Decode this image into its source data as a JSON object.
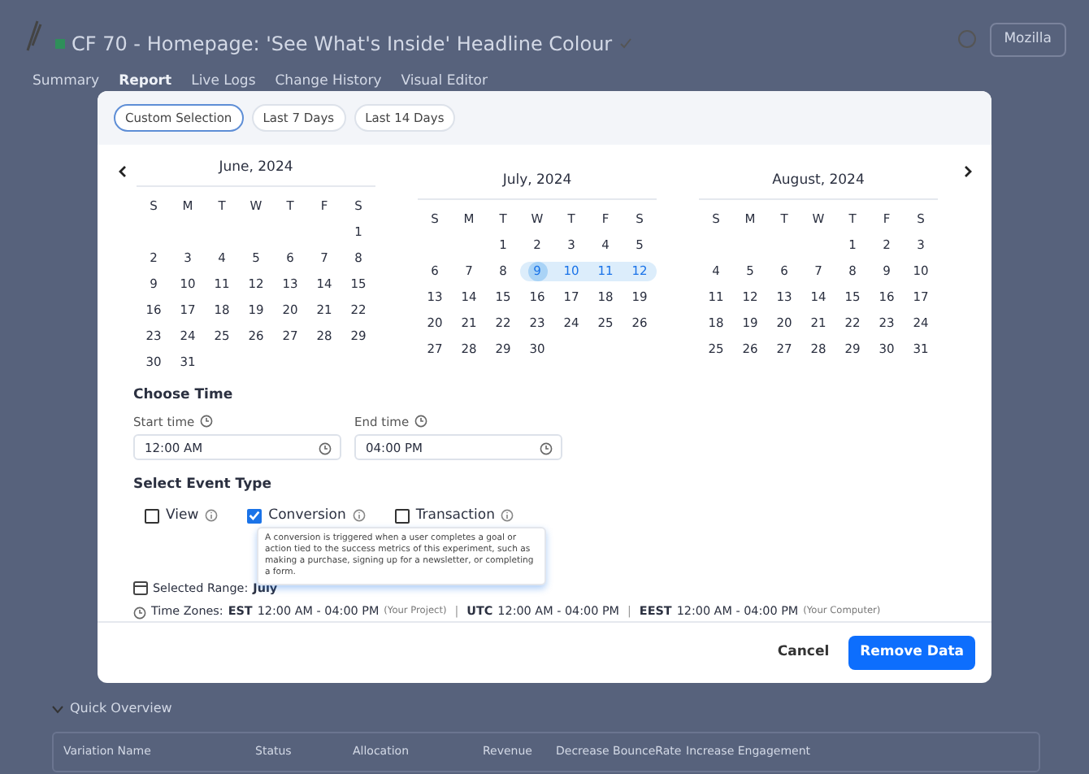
{
  "page": {
    "title": "CF 70 - Homepage: 'See What's Inside' Headline Colour",
    "account": "Mozilla",
    "tabs": [
      {
        "label": "Summary",
        "selected": false
      },
      {
        "label": "Report",
        "selected": true
      },
      {
        "label": "Live Logs",
        "selected": false
      },
      {
        "label": "Change History",
        "selected": false
      },
      {
        "label": "Visual Editor",
        "selected": false
      }
    ],
    "section": "Quick Overview",
    "table_columns": [
      "Variation Name",
      "Status",
      "Allocation",
      "Revenue",
      "Decrease BounceRate",
      "Increase Engagement"
    ]
  },
  "modal": {
    "presets": [
      {
        "label": "Custom Selection",
        "selected": true
      },
      {
        "label": "Last 7 Days",
        "selected": false
      },
      {
        "label": "Last 14 Days",
        "selected": false
      }
    ],
    "months": [
      {
        "title": "June, 2024",
        "weekdays": [
          "S",
          "M",
          "T",
          "W",
          "T",
          "F",
          "S"
        ],
        "weeks": [
          [
            {
              "kind": "blank"
            },
            {
              "kind": "blank"
            },
            {
              "kind": "blank"
            },
            {
              "kind": "blank"
            },
            {
              "kind": "blank"
            },
            {
              "kind": "blank"
            },
            {
              "kind": "day",
              "day": "1",
              "selected": false
            }
          ],
          [
            {
              "kind": "day",
              "day": "2",
              "selected": false
            },
            {
              "kind": "day",
              "day": "3",
              "selected": false
            },
            {
              "kind": "day",
              "day": "4",
              "selected": false
            },
            {
              "kind": "day",
              "day": "5",
              "selected": false
            },
            {
              "kind": "day",
              "day": "6",
              "selected": false
            },
            {
              "kind": "day",
              "day": "7",
              "selected": false
            },
            {
              "kind": "day",
              "day": "8",
              "selected": false
            }
          ],
          [
            {
              "kind": "day",
              "day": "9",
              "selected": false
            },
            {
              "kind": "day",
              "day": "10",
              "selected": false
            },
            {
              "kind": "day",
              "day": "11",
              "selected": false
            },
            {
              "kind": "day",
              "day": "12",
              "selected": false
            },
            {
              "kind": "day",
              "day": "13",
              "selected": false
            },
            {
              "kind": "day",
              "day": "14",
              "selected": false
            },
            {
              "kind": "day",
              "day": "15",
              "selected": false
            }
          ],
          [
            {
              "kind": "day",
              "day": "16",
              "selected": false
            },
            {
              "kind": "day",
              "day": "17",
              "selected": false
            },
            {
              "kind": "day",
              "day": "18",
              "selected": false
            },
            {
              "kind": "day",
              "day": "19",
              "selected": false
            },
            {
              "kind": "day",
              "day": "20",
              "selected": false
            },
            {
              "kind": "day",
              "day": "21",
              "selected": false
            },
            {
              "kind": "day",
              "day": "22",
              "selected": false
            }
          ],
          [
            {
              "kind": "day",
              "day": "23",
              "selected": false
            },
            {
              "kind": "day",
              "day": "24",
              "selected": false
            },
            {
              "kind": "day",
              "day": "25",
              "selected": false
            },
            {
              "kind": "day",
              "day": "26",
              "selected": false
            },
            {
              "kind": "day",
              "day": "27",
              "selected": false
            },
            {
              "kind": "day",
              "day": "28",
              "selected": false
            },
            {
              "kind": "day",
              "day": "29",
              "selected": false
            }
          ],
          [
            {
              "kind": "day",
              "day": "30",
              "selected": false
            },
            {
              "kind": "day",
              "day": "31",
              "selected": false
            }
          ]
        ]
      },
      {
        "title": "July, 2024",
        "weekdays": [
          "S",
          "M",
          "T",
          "W",
          "T",
          "F",
          "S"
        ],
        "weeks": [
          [
            {
              "kind": "blank"
            },
            {
              "kind": "blank"
            },
            {
              "kind": "day",
              "day": "1",
              "selected": false
            },
            {
              "kind": "day",
              "day": "2",
              "selected": false
            },
            {
              "kind": "day",
              "day": "3",
              "selected": false
            },
            {
              "kind": "day",
              "day": "4",
              "selected": false
            },
            {
              "kind": "day",
              "day": "5",
              "selected": false
            }
          ],
          [
            {
              "kind": "day",
              "day": "6",
              "selected": false
            },
            {
              "kind": "day",
              "day": "7",
              "selected": false
            },
            {
              "kind": "day",
              "day": "8",
              "selected": false
            },
            {
              "kind": "day",
              "day": "9",
              "selected": true
            },
            {
              "kind": "day",
              "day": "10",
              "selected": true
            },
            {
              "kind": "day",
              "day": "11",
              "selected": true
            },
            {
              "kind": "day",
              "day": "12",
              "selected": true
            }
          ],
          [
            {
              "kind": "day",
              "day": "13",
              "selected": false
            },
            {
              "kind": "day",
              "day": "14",
              "selected": false
            },
            {
              "kind": "day",
              "day": "15",
              "selected": false
            },
            {
              "kind": "day",
              "day": "16",
              "selected": false
            },
            {
              "kind": "day",
              "day": "17",
              "selected": false
            },
            {
              "kind": "day",
              "day": "18",
              "selected": false
            },
            {
              "kind": "day",
              "day": "19",
              "selected": false
            }
          ],
          [
            {
              "kind": "day",
              "day": "20",
              "selected": false
            },
            {
              "kind": "day",
              "day": "21",
              "selected": false
            },
            {
              "kind": "day",
              "day": "22",
              "selected": false
            },
            {
              "kind": "day",
              "day": "23",
              "selected": false
            },
            {
              "kind": "day",
              "day": "24",
              "selected": false
            },
            {
              "kind": "day",
              "day": "25",
              "selected": false
            },
            {
              "kind": "day",
              "day": "26",
              "selected": false
            }
          ],
          [
            {
              "kind": "day",
              "day": "27",
              "selected": false
            },
            {
              "kind": "day",
              "day": "28",
              "selected": false
            },
            {
              "kind": "day",
              "day": "29",
              "selected": false
            },
            {
              "kind": "day",
              "day": "30",
              "selected": false
            }
          ]
        ]
      },
      {
        "title": "August, 2024",
        "weekdays": [
          "S",
          "M",
          "T",
          "W",
          "T",
          "F",
          "S"
        ],
        "weeks": [
          [
            {
              "kind": "blank"
            },
            {
              "kind": "blank"
            },
            {
              "kind": "blank"
            },
            {
              "kind": "blank"
            },
            {
              "kind": "day",
              "day": "1",
              "selected": false
            },
            {
              "kind": "day",
              "day": "2",
              "selected": false
            },
            {
              "kind": "day",
              "day": "3",
              "selected": false
            }
          ],
          [
            {
              "kind": "day",
              "day": "4",
              "selected": false
            },
            {
              "kind": "day",
              "day": "5",
              "selected": false
            },
            {
              "kind": "day",
              "day": "6",
              "selected": false
            },
            {
              "kind": "day",
              "day": "7",
              "selected": false
            },
            {
              "kind": "day",
              "day": "8",
              "selected": false
            },
            {
              "kind": "day",
              "day": "9",
              "selected": false
            },
            {
              "kind": "day",
              "day": "10",
              "selected": false
            }
          ],
          [
            {
              "kind": "day",
              "day": "11",
              "selected": false
            },
            {
              "kind": "day",
              "day": "12",
              "selected": false
            },
            {
              "kind": "day",
              "day": "13",
              "selected": false
            },
            {
              "kind": "day",
              "day": "14",
              "selected": false
            },
            {
              "kind": "day",
              "day": "15",
              "selected": false
            },
            {
              "kind": "day",
              "day": "16",
              "selected": false
            },
            {
              "kind": "day",
              "day": "17",
              "selected": false
            }
          ],
          [
            {
              "kind": "day",
              "day": "18",
              "selected": false
            },
            {
              "kind": "day",
              "day": "19",
              "selected": false
            },
            {
              "kind": "day",
              "day": "20",
              "selected": false
            },
            {
              "kind": "day",
              "day": "21",
              "selected": false
            },
            {
              "kind": "day",
              "day": "22",
              "selected": false
            },
            {
              "kind": "day",
              "day": "23",
              "selected": false
            },
            {
              "kind": "day",
              "day": "24",
              "selected": false
            }
          ],
          [
            {
              "kind": "day",
              "day": "25",
              "selected": false
            },
            {
              "kind": "day",
              "day": "26",
              "selected": false
            },
            {
              "kind": "day",
              "day": "27",
              "selected": false
            },
            {
              "kind": "day",
              "day": "28",
              "selected": false
            },
            {
              "kind": "day",
              "day": "29",
              "selected": false
            },
            {
              "kind": "day",
              "day": "30",
              "selected": false
            },
            {
              "kind": "day",
              "day": "31",
              "selected": false
            }
          ]
        ]
      }
    ],
    "time": {
      "heading": "Choose Time",
      "fields": [
        {
          "label": "Start time",
          "value": "12:00 AM"
        },
        {
          "label": "End time",
          "value": "04:00 PM"
        }
      ]
    },
    "event_type": {
      "heading": "Select Event Type",
      "options": [
        {
          "label": "View",
          "checked": false
        },
        {
          "label": "Conversion",
          "checked": true
        },
        {
          "label": "Transaction",
          "checked": false
        }
      ]
    },
    "tooltip": "A conversion is triggered when a user completes a goal or action tied to the success metrics of this experiment, such as making a purchase, signing up for a newsletter, or completing a form.",
    "selected_range": {
      "label": "Selected Range:",
      "value": "July"
    },
    "time_zones": {
      "label": "Time Zones:",
      "zones": [
        {
          "code": "EST",
          "range": "12:00 AM - 04:00 PM",
          "note": "(Your Project)"
        },
        {
          "separator": "|",
          "code": "UTC",
          "range": "12:00 AM - 04:00 PM"
        },
        {
          "separator": "|",
          "code": "EEST",
          "range": "12:00 AM - 04:00 PM",
          "note": "(Your Computer)"
        }
      ]
    },
    "buttons": [
      {
        "label": "Cancel",
        "kind": "link"
      },
      {
        "label": "Remove Data",
        "kind": "primary"
      }
    ]
  }
}
